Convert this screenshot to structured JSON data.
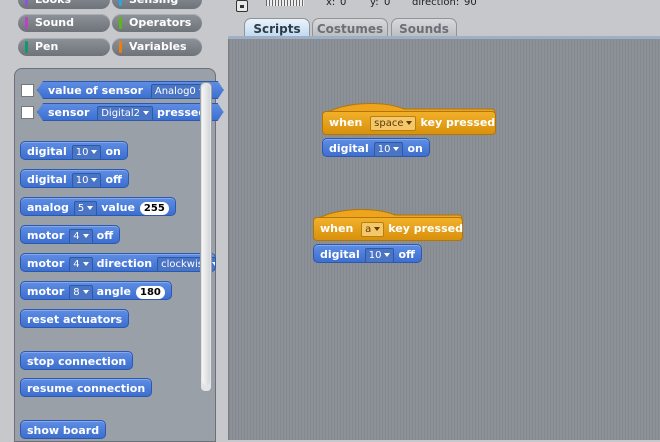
{
  "categories": [
    {
      "label": "Looks",
      "color": "#8a55d7"
    },
    {
      "label": "Sensing",
      "color": "#2ca5e2"
    },
    {
      "label": "Sound",
      "color": "#bb42c3"
    },
    {
      "label": "Operators",
      "color": "#5cb712"
    },
    {
      "label": "Pen",
      "color": "#0e9a6c"
    },
    {
      "label": "Variables",
      "color": "#ee7d16"
    }
  ],
  "topbar": {
    "x_label": "x:",
    "x_value": "0",
    "y_label": "y:",
    "y_value": "0",
    "direction_label": "direction:",
    "direction_value": "90"
  },
  "tabs": [
    {
      "label": "Scripts"
    },
    {
      "label": "Costumes"
    },
    {
      "label": "Sounds"
    }
  ],
  "palette": {
    "sensor_value": {
      "word": "value of sensor",
      "option": "Analog0"
    },
    "sensor_pressed": {
      "word": "sensor",
      "option": "Digital2",
      "suffix": "pressed?"
    },
    "digital_on": {
      "word": "digital",
      "pin": "10",
      "state": "on"
    },
    "digital_off": {
      "word": "digital",
      "pin": "10",
      "state": "off"
    },
    "analog": {
      "word": "analog",
      "pin": "5",
      "value_word": "value",
      "value": "255"
    },
    "motor_off": {
      "word": "motor",
      "pin": "4",
      "state": "off"
    },
    "motor_dir": {
      "word": "motor",
      "pin": "4",
      "dir_word": "direction",
      "dir": "clockwise"
    },
    "motor_angle": {
      "word": "motor",
      "pin": "8",
      "angle_word": "angle",
      "angle": "180"
    },
    "reset": "reset actuators",
    "stop": "stop connection",
    "resume": "resume connection",
    "show": "show board"
  },
  "scripts": [
    {
      "when": "when",
      "key": "space",
      "suffix": "key pressed",
      "cmd": "digital",
      "pin": "10",
      "state": "on"
    },
    {
      "when": "when",
      "key": "a",
      "suffix": "key pressed",
      "cmd": "digital",
      "pin": "10",
      "state": "off"
    }
  ],
  "colors": {
    "control": "#f0a51e",
    "motion": "#4a7ad9"
  }
}
